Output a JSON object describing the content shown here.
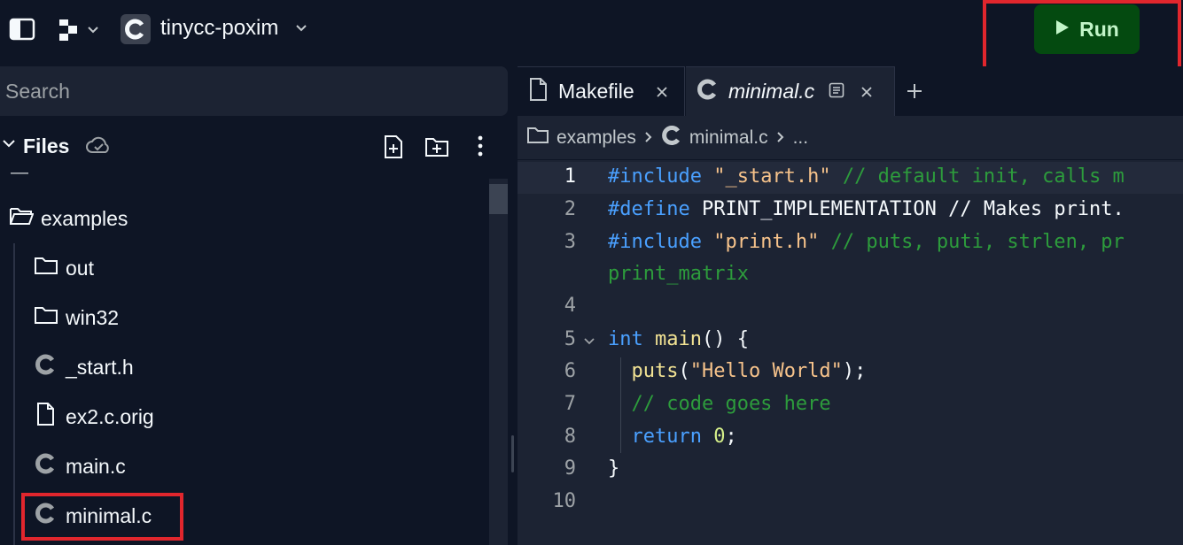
{
  "topbar": {
    "project_name": "tinycc-poxim",
    "run_label": "Run"
  },
  "sidebar": {
    "search_placeholder": "Search",
    "files_title": "Files",
    "tree": {
      "collapsed_marker": "—",
      "root_folder": "examples",
      "items": [
        {
          "label": "out",
          "type": "folder"
        },
        {
          "label": "win32",
          "type": "folder"
        },
        {
          "label": "_start.h",
          "type": "c-file"
        },
        {
          "label": "ex2.c.orig",
          "type": "file"
        },
        {
          "label": "main.c",
          "type": "c-file"
        },
        {
          "label": "minimal.c",
          "type": "c-file"
        }
      ]
    }
  },
  "editor": {
    "tabs": [
      {
        "label": "Makefile",
        "active": false
      },
      {
        "label": "minimal.c",
        "active": true
      }
    ],
    "breadcrumb": {
      "folder": "examples",
      "file": "minimal.c",
      "more": "..."
    },
    "gutter": [
      "1",
      "2",
      "3",
      "",
      "4",
      "5",
      "6",
      "7",
      "8",
      "9",
      "10"
    ],
    "code": {
      "l1_kw": "#include",
      "l1_str": " \"_start.h\"",
      "l1_cm": " // default init, calls m",
      "l2_kw": "#define",
      "l2_rest": " PRINT_IMPLEMENTATION // Makes print.",
      "l3_kw": "#include",
      "l3_str": " \"print.h\"",
      "l3_cm": " // puts, puti, strlen, pr",
      "l3b_cm": "print_matrix",
      "l5_kw": "int",
      "l5_fn": " main",
      "l5_rest": "() {",
      "l6_fn": "  puts",
      "l6_p1": "(",
      "l6_str": "\"Hello World\"",
      "l6_p2": ");",
      "l7_cm": "  // code goes here",
      "l8_kw": "  return",
      "l8_num": " 0",
      "l8_rest": ";",
      "l9": "}"
    }
  },
  "colors": {
    "background": "#0e1525",
    "panel": "#1c2333",
    "run_button": "#044a10",
    "highlight_box": "#e1262d"
  }
}
